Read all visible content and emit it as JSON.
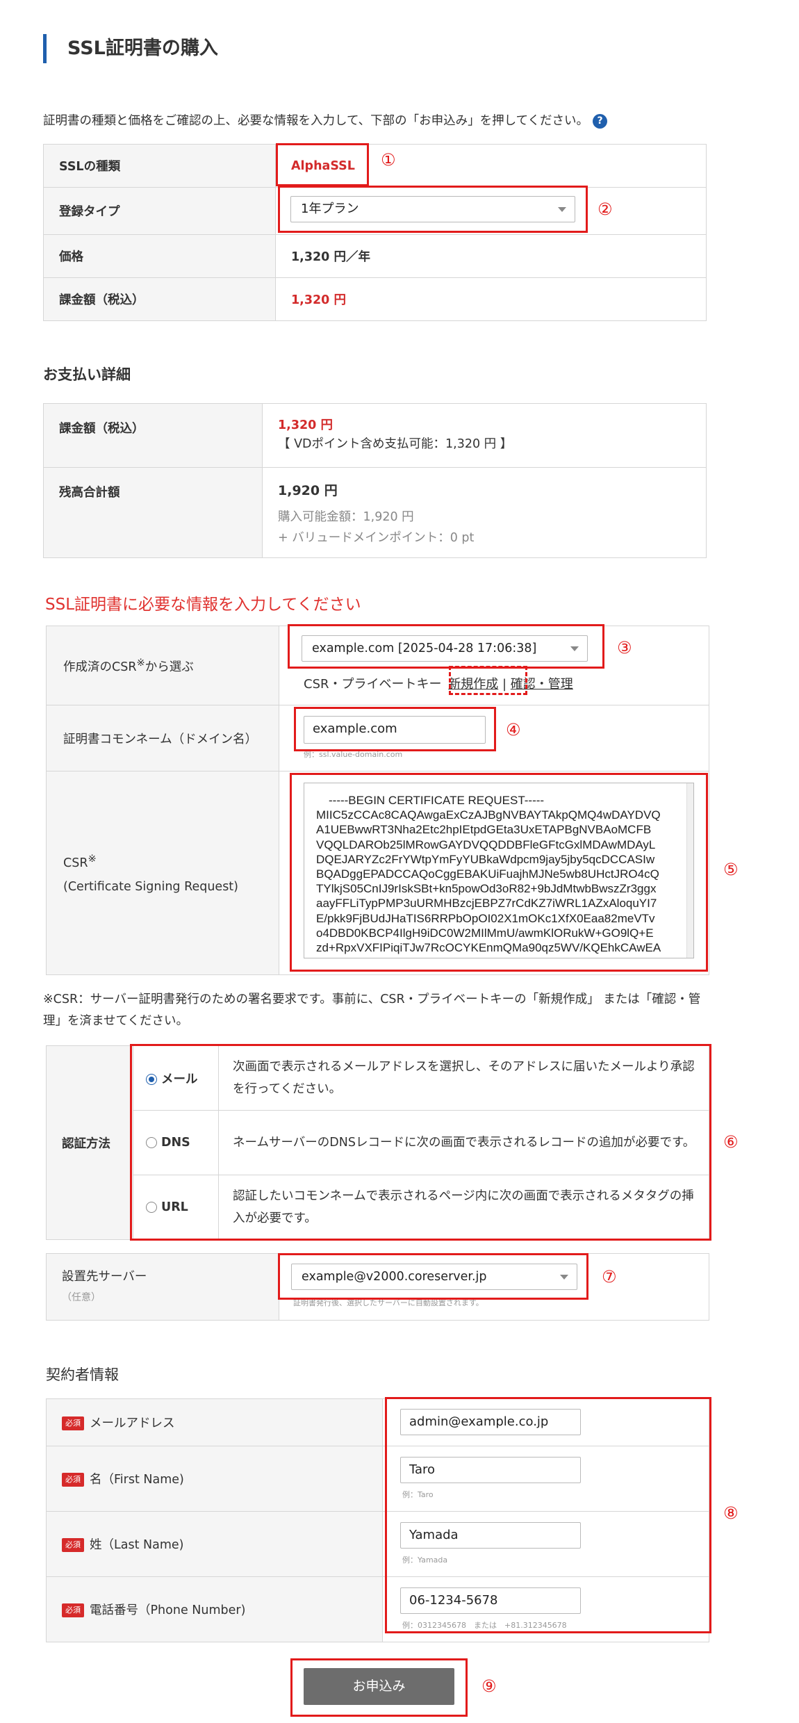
{
  "page": {
    "title": "SSL証明書の購入",
    "intro": "証明書の種類と価格をご確認の上、必要な情報を入力して、下部の「お申込み」を押してください。",
    "help_icon": "?"
  },
  "purchase": {
    "ssl_type_label": "SSLの種類",
    "ssl_type_value": "AlphaSSL",
    "reg_type_label": "登録タイプ",
    "reg_type_value": "1年プラン",
    "price_label": "価格",
    "price_value": "1,320 円／年",
    "billing_label": "課金額（税込）",
    "billing_value": "1,320 円"
  },
  "payment": {
    "section_title": "お支払い詳細",
    "billing_label": "課金額（税込）",
    "billing_value": "1,320 円",
    "points_note": "【 VDポイント含め支払可能：1,320 円 】",
    "balance_label": "残高合計額",
    "balance_value": "1,920 円",
    "available": "購入可能金額：1,920 円",
    "points": "+ バリュードメインポイント：0 pt"
  },
  "ssl_info": {
    "section_title": "SSL証明書に必要な情報を入力してください",
    "csr_select_label": "作成済のCSR",
    "csr_select_sup": "※",
    "csr_select_label_tail": "から選ぶ",
    "csr_select_value": "example.com [2025-04-28 17:06:38]",
    "csr_key_text": "CSR・プライベートキー",
    "csr_new_link": "新規作成",
    "csr_sep": "|",
    "csr_manage_link": "確認・管理",
    "common_name_label": "証明書コモンネーム（ドメイン名）",
    "common_name_value": "example.com",
    "common_name_example": "例：ssl.value-domain.com",
    "csr_label": "CSR",
    "csr_label_sup": "※",
    "csr_label_sub": "(Certificate Signing Request)",
    "csr_lines": [
      "-----BEGIN CERTIFICATE REQUEST-----",
      "MIIC5zCCAc8CAQAwgaExCzAJBgNVBAYTAkpQMQ4wDAYDVQ",
      "A1UEBwwRT3Nha2Etc2hpIEtpdGEta3UxETAPBgNVBAoMCFB",
      "VQQLDAROb25lMRowGAYDVQQDDBFleGFtcGxlMDAwMDAyL",
      "DQEJARYZc2FrYWtpYmFyYUBkaWdpcm9jay5jby5qcDCCASIw",
      "BQADggEPADCCAQoCggEBAKUiFuajhMJNe5wb8UHctJRO4cQ",
      "TYlkjS05CnIJ9rIskSBt+kn5powOd3oR82+9bJdMtwbBwszZr3ggx",
      "aayFFLiTypPMP3uURMHBzcjEBPZ7rCdKZ7iWRL1AZxAloquYI7",
      "E/pkk9FjBUdJHaTIS6RRPbOpOI02X1mOKc1XfX0Eaa82meVTv",
      "o4DBD0KBCP4IlgH9iDC0W2MIlMmU/awmKlORukW+GO9lQ+E",
      "zd+RpxVXFIPiqiTJw7RcOCYKEnmQMa90qz5WV/KQEhkCAwEA"
    ],
    "csr_footnote": "※CSR：サーバー証明書発行のための署名要求です。事前に、CSR・プライベートキーの「新規作成」 または「確認・管理」を済ませてください。"
  },
  "auth": {
    "label": "認証方法",
    "options": [
      {
        "label": "メール",
        "selected": true,
        "desc": "次画面で表示されるメールアドレスを選択し、そのアドレスに届いたメールより承認を行ってください。"
      },
      {
        "label": "DNS",
        "selected": false,
        "desc": "ネームサーバーのDNSレコードに次の画面で表示されるレコードの追加が必要です。"
      },
      {
        "label": "URL",
        "selected": false,
        "desc": "認証したいコモンネームで表示されるページ内に次の画面で表示されるメタタグの挿入が必要です。"
      }
    ]
  },
  "server": {
    "label": "設置先サーバー",
    "optional": "（任意）",
    "value": "example@v2000.coreserver.jp",
    "note": "証明書発行後、選択したサーバーに自動設置されます。"
  },
  "contact": {
    "section_title": "契約者情報",
    "required_badge": "必須",
    "fields": [
      {
        "label": "メールアドレス",
        "value": "admin@example.co.jp",
        "example": ""
      },
      {
        "label": "名（First Name)",
        "value": "Taro",
        "example": "例：Taro"
      },
      {
        "label": "姓（Last Name)",
        "value": "Yamada",
        "example": "例：Yamada"
      },
      {
        "label": "電話番号（Phone Number)",
        "value": "06-1234-5678",
        "example": "例：0312345678　または　+81.312345678"
      }
    ]
  },
  "submit_label": "お申込み",
  "markers": [
    "①",
    "②",
    "③",
    "④",
    "⑤",
    "⑥",
    "⑦",
    "⑧",
    "⑨"
  ],
  "colors": {
    "accent": "#1f5fad",
    "alert_red": "#d32b2b",
    "annotation_red": "#e21b1b",
    "button": "#6d6d6d"
  }
}
